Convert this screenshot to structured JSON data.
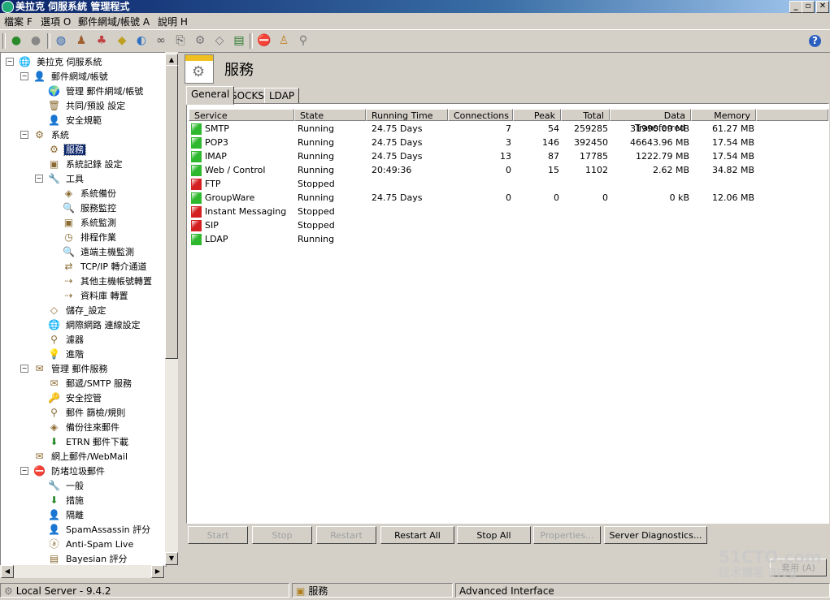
{
  "window": {
    "title": "美拉克 伺服系統 管理程式"
  },
  "menu": [
    "檔案 F",
    "選項 O",
    "郵件網域/帳號 A",
    "說明 H"
  ],
  "tree": [
    {
      "label": "美拉克 伺服系統",
      "level": 0,
      "icon": "globe-icon",
      "glyph": "🌐",
      "expander": "−"
    },
    {
      "label": "郵件網域/帳號",
      "level": 1,
      "icon": "user-icon",
      "glyph": "👤",
      "expander": "−"
    },
    {
      "label": "管理 郵件網域/帳號",
      "level": 2,
      "icon": "mail-globe-icon",
      "glyph": "🌍"
    },
    {
      "label": "共同/預設 設定",
      "level": 2,
      "icon": "trash-icon",
      "glyph": "🗑"
    },
    {
      "label": "安全規範",
      "level": 2,
      "icon": "user-shield-icon",
      "glyph": "👤"
    },
    {
      "label": "系統",
      "level": 1,
      "icon": "gear-icon",
      "glyph": "⚙",
      "expander": "−"
    },
    {
      "label": "服務",
      "level": 2,
      "icon": "services-icon",
      "glyph": "⚙",
      "selected": true
    },
    {
      "label": "系統記錄 設定",
      "level": 2,
      "icon": "monitor-icon",
      "glyph": "▣"
    },
    {
      "label": "工具",
      "level": 2,
      "icon": "tools-icon",
      "glyph": "🔧",
      "expander": "−"
    },
    {
      "label": "系統備份",
      "level": 3,
      "icon": "backup-icon",
      "glyph": "◈"
    },
    {
      "label": "服務監控",
      "level": 3,
      "icon": "magnifier-icon",
      "glyph": "🔍"
    },
    {
      "label": "系統監測",
      "level": 3,
      "icon": "monitor-icon",
      "glyph": "▣"
    },
    {
      "label": "排程作業",
      "level": 3,
      "icon": "clock-icon",
      "glyph": "◷"
    },
    {
      "label": "遠端主機監測",
      "level": 3,
      "icon": "magnifier-icon",
      "glyph": "🔍"
    },
    {
      "label": "TCP/IP 轉介通道",
      "level": 3,
      "icon": "network-icon",
      "glyph": "⇄"
    },
    {
      "label": "其他主機帳號轉置",
      "level": 3,
      "icon": "import-icon",
      "glyph": "⇢"
    },
    {
      "label": "資料庫 轉置",
      "level": 3,
      "icon": "database-icon",
      "glyph": "⇢"
    },
    {
      "label": "儲存_設定",
      "level": 2,
      "icon": "disk-icon",
      "glyph": "◇"
    },
    {
      "label": "網際網路 連線設定",
      "level": 2,
      "icon": "globe-icon",
      "glyph": "🌐"
    },
    {
      "label": "濾器",
      "level": 2,
      "icon": "filter-icon",
      "glyph": "⚲"
    },
    {
      "label": "進階",
      "level": 2,
      "icon": "lightbulb-icon",
      "glyph": "💡"
    },
    {
      "label": "管理 郵件服務",
      "level": 1,
      "icon": "mail-service-icon",
      "glyph": "✉",
      "expander": "−"
    },
    {
      "label": "郵遞/SMTP 服務",
      "level": 2,
      "icon": "envelope-icon",
      "glyph": "✉"
    },
    {
      "label": "安全控管",
      "level": 2,
      "icon": "key-icon",
      "glyph": "🔑"
    },
    {
      "label": "郵件 篩檢/規則",
      "level": 2,
      "icon": "filter-icon",
      "glyph": "⚲"
    },
    {
      "label": "備份往來郵件",
      "level": 2,
      "icon": "backup-icon",
      "glyph": "◈"
    },
    {
      "label": "ETRN 郵件下載",
      "level": 2,
      "icon": "download-arrow-icon",
      "glyph": "⬇"
    },
    {
      "label": "網上郵件/WebMail",
      "level": 1,
      "icon": "webmail-icon",
      "glyph": "✉"
    },
    {
      "label": "防堵垃圾郵件",
      "level": 1,
      "icon": "no-entry-icon",
      "glyph": "⛔",
      "expander": "−"
    },
    {
      "label": "一般",
      "level": 2,
      "icon": "tools-icon",
      "glyph": "🔧"
    },
    {
      "label": "措施",
      "level": 2,
      "icon": "download-arrow-icon",
      "glyph": "⬇"
    },
    {
      "label": "隔離",
      "level": 2,
      "icon": "user-icon",
      "glyph": "👤"
    },
    {
      "label": "SpamAssassin 評分",
      "level": 2,
      "icon": "user-icon",
      "glyph": "👤"
    },
    {
      "label": "Anti-Spam Live",
      "level": 2,
      "icon": "antispam-icon",
      "glyph": "ⓐ"
    },
    {
      "label": "Bayesian 評分",
      "level": 2,
      "icon": "book-icon",
      "glyph": "▤"
    }
  ],
  "panel": {
    "title": "服務"
  },
  "tabs": [
    "General",
    "SOCKS",
    "LDAP"
  ],
  "columns": [
    "Service",
    "State",
    "Running Time",
    "Connections",
    "Peak",
    "Total",
    "Data Transferred",
    "Memory"
  ],
  "services": [
    {
      "name": "SMTP",
      "state": "Running",
      "time": "24.75 Days",
      "connections": "7",
      "peak": "54",
      "total": "259285",
      "data": "31990.09 MB",
      "memory": "61.27 MB",
      "status": "running"
    },
    {
      "name": "POP3",
      "state": "Running",
      "time": "24.75 Days",
      "connections": "3",
      "peak": "146",
      "total": "392450",
      "data": "46643.96 MB",
      "memory": "17.54 MB",
      "status": "running"
    },
    {
      "name": "IMAP",
      "state": "Running",
      "time": "24.75 Days",
      "connections": "13",
      "peak": "87",
      "total": "17785",
      "data": "1222.79 MB",
      "memory": "17.54 MB",
      "status": "running"
    },
    {
      "name": "Web / Control",
      "state": "Running",
      "time": "20:49:36",
      "connections": "0",
      "peak": "15",
      "total": "1102",
      "data": "2.62 MB",
      "memory": "34.82 MB",
      "status": "running"
    },
    {
      "name": "FTP",
      "state": "Stopped",
      "time": "",
      "connections": "",
      "peak": "",
      "total": "",
      "data": "",
      "memory": "",
      "status": "stopped"
    },
    {
      "name": "GroupWare",
      "state": "Running",
      "time": "24.75 Days",
      "connections": "0",
      "peak": "0",
      "total": "0",
      "data": "0 kB",
      "memory": "12.06 MB",
      "status": "running"
    },
    {
      "name": "Instant Messaging",
      "state": "Stopped",
      "time": "",
      "connections": "",
      "peak": "",
      "total": "",
      "data": "",
      "memory": "",
      "status": "stopped"
    },
    {
      "name": "SIP",
      "state": "Stopped",
      "time": "",
      "connections": "",
      "peak": "",
      "total": "",
      "data": "",
      "memory": "",
      "status": "stopped"
    },
    {
      "name": "LDAP",
      "state": "Running",
      "time": "",
      "connections": "",
      "peak": "",
      "total": "",
      "data": "",
      "memory": "",
      "status": "running"
    }
  ],
  "buttons": [
    {
      "label": "Start",
      "enabled": false
    },
    {
      "label": "Stop",
      "enabled": false
    },
    {
      "label": "Restart",
      "enabled": false
    },
    {
      "label": "Restart All",
      "enabled": true
    },
    {
      "label": "Stop All",
      "enabled": true
    },
    {
      "label": "Properties...",
      "enabled": false
    },
    {
      "label": "Server Diagnostics...",
      "enabled": true
    }
  ],
  "apply_label": "套用 (A)",
  "status": {
    "server": "Local Server - 9.4.2",
    "section": "服務",
    "mode": "Advanced Interface"
  },
  "watermark": [
    "51CTO.com",
    "技术博客 Blog"
  ],
  "colors": {
    "running": "#2db82d",
    "stopped": "#d42020",
    "selection": "#0a246a"
  }
}
